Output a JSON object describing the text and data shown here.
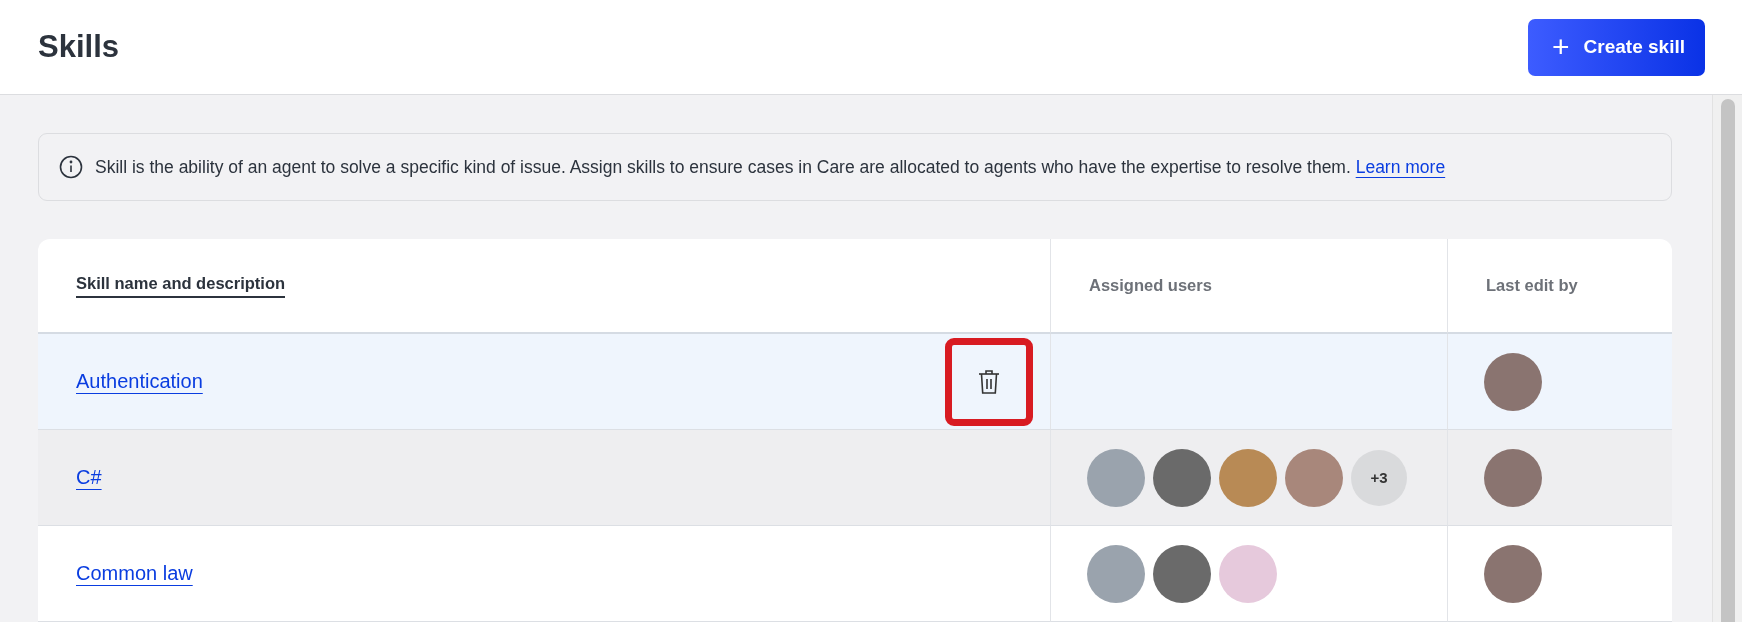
{
  "page": {
    "title": "Skills"
  },
  "create_button": {
    "icon": "+",
    "label": "Create skill"
  },
  "info": {
    "text": "Skill is the ability of an agent to solve a specific kind of issue. Assign skills to ensure cases in Care are allocated to agents who have the expertise to resolve them.",
    "link": "Learn more"
  },
  "table": {
    "columns": [
      {
        "label": "Skill name and description",
        "sorted": true
      },
      {
        "label": "Assigned users",
        "sorted": false
      },
      {
        "label": "Last edit by",
        "sorted": false
      }
    ],
    "rows": [
      {
        "name": "Authentication",
        "selected": true,
        "striped": false,
        "delete_outlined": true,
        "assigned": [],
        "last_edit": {
          "color": "#8a7470"
        }
      },
      {
        "name": "C#",
        "selected": false,
        "striped": true,
        "delete_outlined": false,
        "assigned": [
          {
            "color": "#9aa3ad"
          },
          {
            "color": "#6a6a6a"
          },
          {
            "color": "#b88a55"
          },
          {
            "color": "#a8877b"
          }
        ],
        "more": "+3",
        "last_edit": {
          "color": "#8a7470"
        }
      },
      {
        "name": "Common law",
        "selected": false,
        "striped": false,
        "delete_outlined": false,
        "assigned": [
          {
            "color": "#9aa3ad"
          },
          {
            "color": "#6a6a6a"
          },
          {
            "color": "#e6c9dc"
          }
        ],
        "last_edit": {
          "color": "#8a7470"
        }
      }
    ]
  }
}
